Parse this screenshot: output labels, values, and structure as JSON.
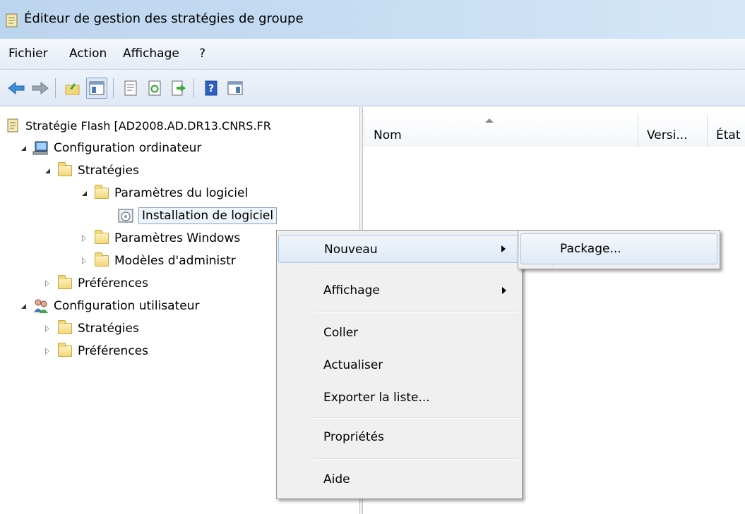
{
  "window": {
    "title": "Éditeur de gestion des stratégies de groupe"
  },
  "menu": [
    "Fichier",
    "Action",
    "Affichage",
    "?"
  ],
  "toolbar": {
    "icons": [
      "back-arrow-icon",
      "forward-arrow-icon",
      "up-folder-icon",
      "show-hide-tree-icon",
      "properties-icon",
      "refresh-icon",
      "export-list-icon",
      "help-icon",
      "show-action-pane-icon"
    ],
    "pressed": "show-hide-tree-icon"
  },
  "tree": {
    "root": "Stratégie Flash [AD2008.AD.DR13.CNRS.FR",
    "computer_config": "Configuration ordinateur",
    "comp_policies": "Stratégies",
    "software_settings": "Paramètres du logiciel",
    "software_install": "Installation de logiciel",
    "windows_settings": "Paramètres Windows",
    "admin_templates": "Modèles d'administr",
    "comp_preferences": "Préférences",
    "user_config": "Configuration utilisateur",
    "user_policies": "Stratégies",
    "user_preferences": "Préférences"
  },
  "list": {
    "columns": [
      "Nom",
      "Versi...",
      "État"
    ]
  },
  "context_menu": {
    "new": "Nouveau",
    "view": "Affichage",
    "paste": "Coller",
    "refresh": "Actualiser",
    "export": "Exporter la liste...",
    "properties": "Propriétés",
    "help": "Aide"
  },
  "submenu": {
    "package": "Package..."
  },
  "colors": {
    "titlebar": "#c5dcf2",
    "highlight_border": "#a8c4e8",
    "menu_bg": "#f0f0f0"
  }
}
